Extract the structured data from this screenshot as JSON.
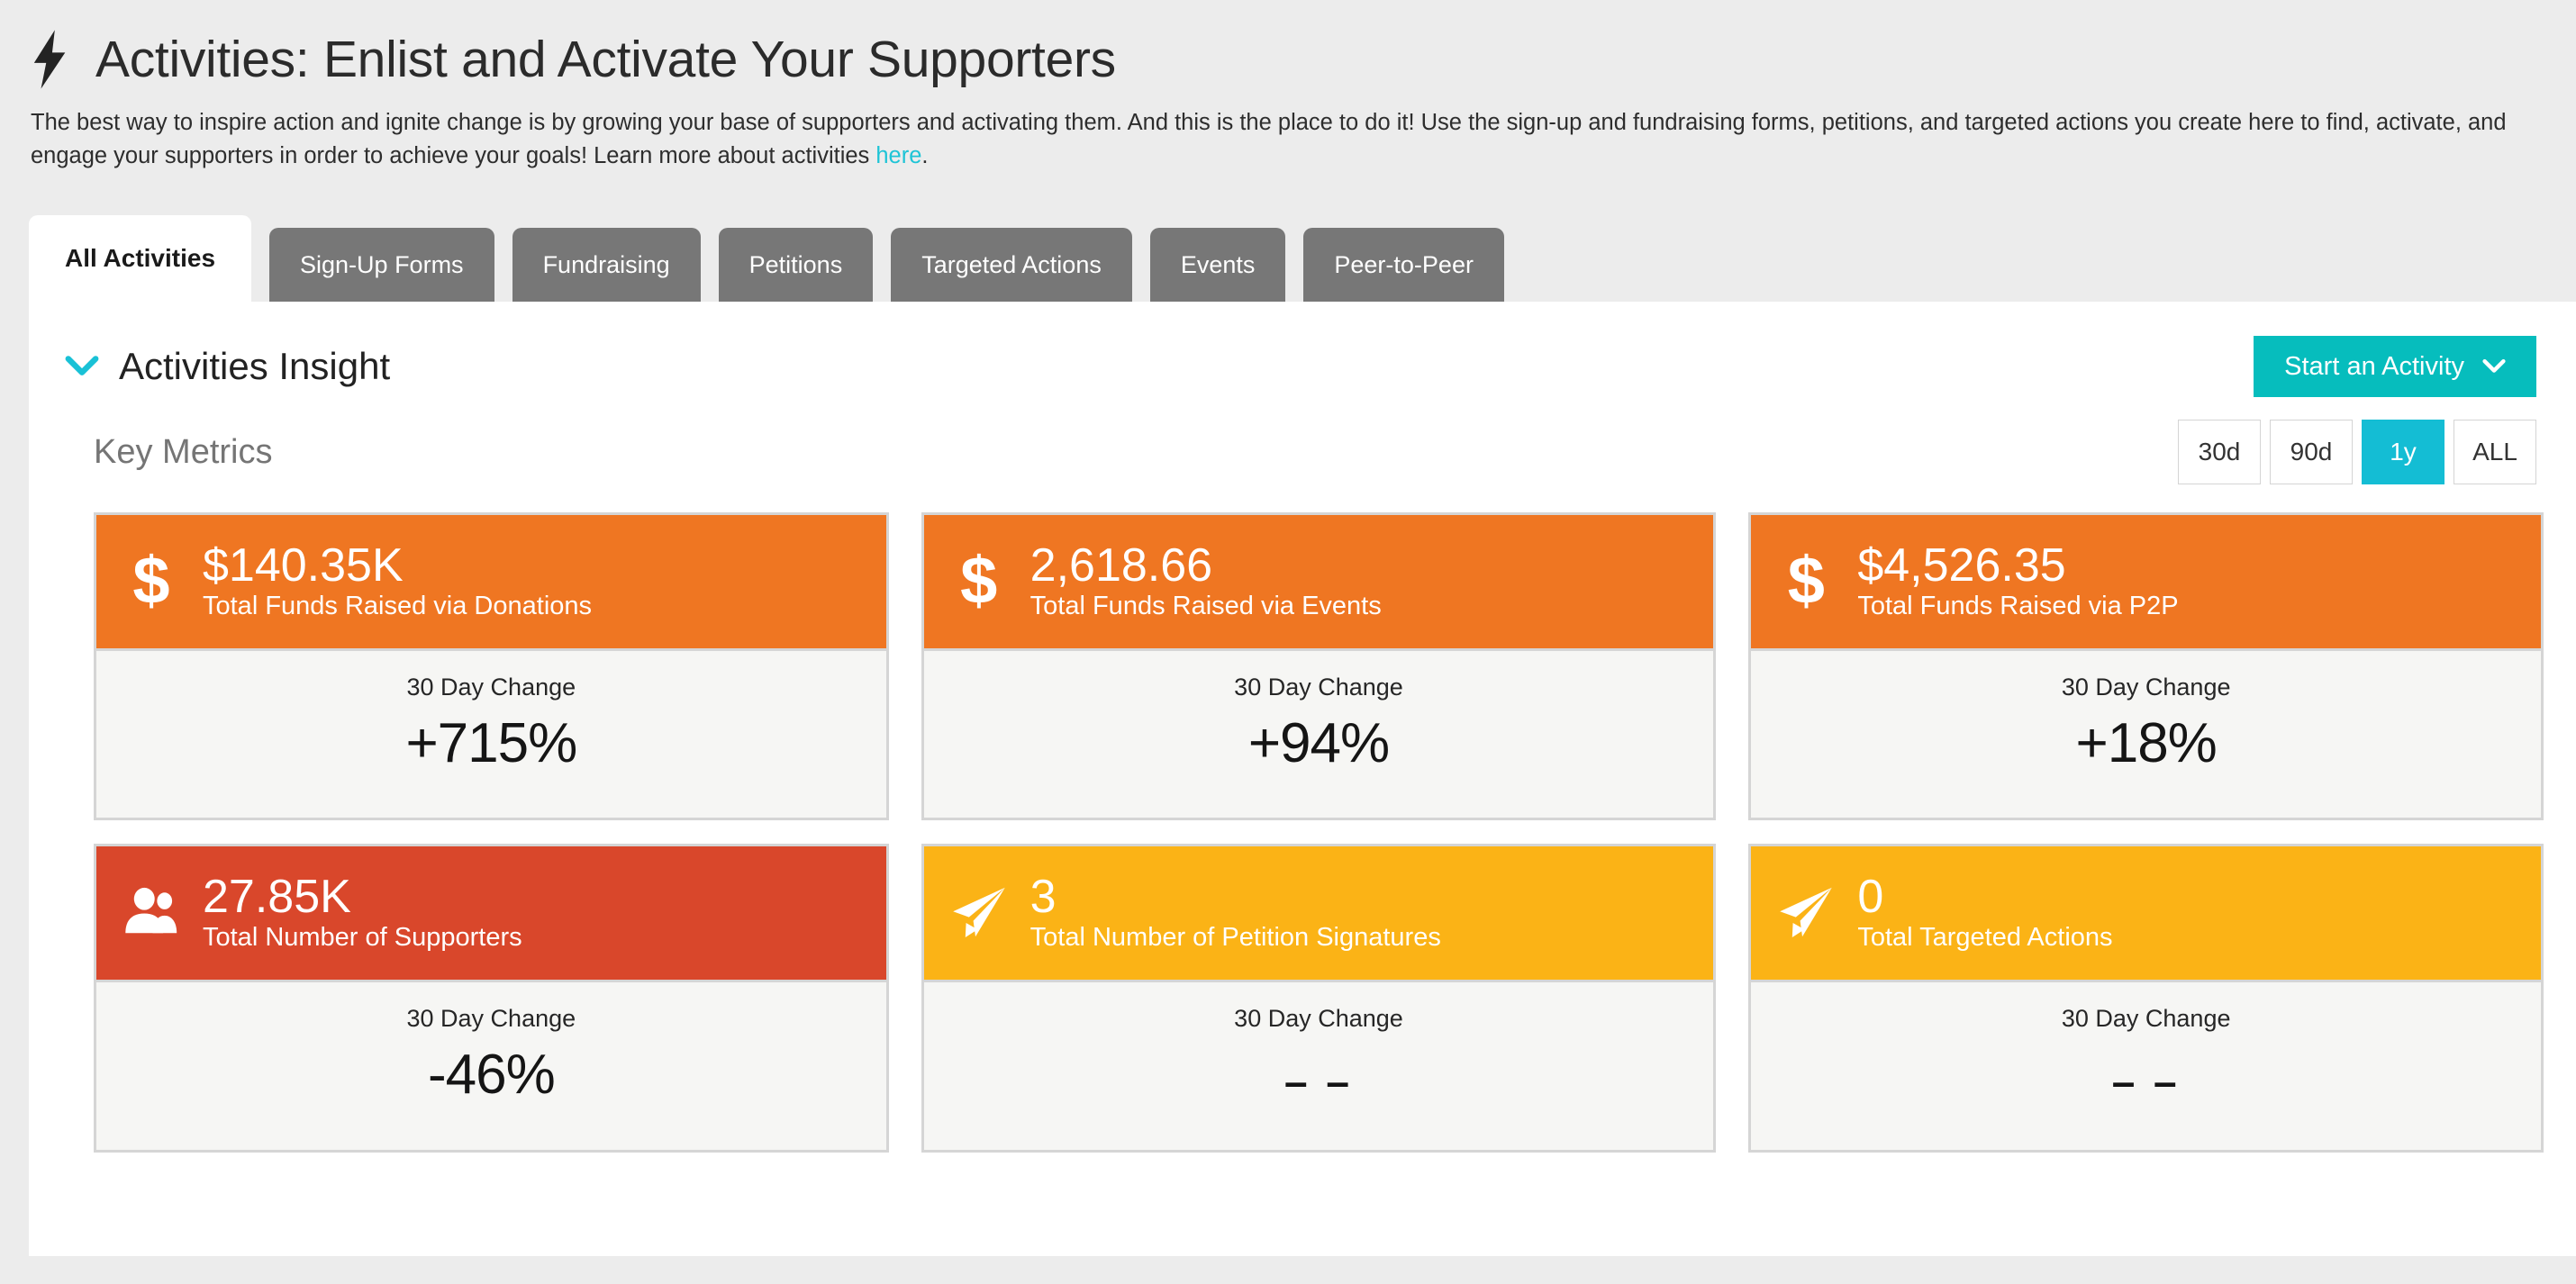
{
  "header": {
    "icon": "bolt-icon",
    "title": "Activities: Enlist and Activate Your Supporters"
  },
  "intro": {
    "text_before_link": "The best way to inspire action and ignite change is by growing your base of supporters and activating them. And this is the place to do it! Use the sign-up and fundraising forms, petitions, and targeted actions you create here to find, activate, and engage your supporters in order to achieve your goals! Learn more about activities ",
    "link_label": "here",
    "text_after_link": ".",
    "link_color": "#1ec4d6"
  },
  "tabs": [
    {
      "label": "All Activities",
      "active": true
    },
    {
      "label": "Sign-Up Forms",
      "active": false
    },
    {
      "label": "Fundraising",
      "active": false
    },
    {
      "label": "Petitions",
      "active": false
    },
    {
      "label": "Targeted Actions",
      "active": false
    },
    {
      "label": "Events",
      "active": false
    },
    {
      "label": "Peer-to-Peer",
      "active": false
    }
  ],
  "insight": {
    "title": "Activities Insight",
    "collapse_icon": "chevron-down-icon",
    "start_button": {
      "label": "Start an Activity",
      "icon": "chevron-down-icon",
      "color": "#06bdbd"
    }
  },
  "key_metrics": {
    "label": "Key Metrics",
    "ranges": [
      {
        "label": "30d",
        "active": false
      },
      {
        "label": "90d",
        "active": false
      },
      {
        "label": "1y",
        "active": true
      },
      {
        "label": "ALL",
        "active": false
      }
    ],
    "active_range_color": "#14bdd4"
  },
  "cards": [
    {
      "icon": "dollar-icon",
      "value": "$140.35K",
      "label": "Total Funds Raised via Donations",
      "header_color": "#ef7622",
      "change_label": "30 Day Change",
      "change_value": "+715%"
    },
    {
      "icon": "dollar-icon",
      "value": "2,618.66",
      "label": "Total Funds Raised via Events",
      "header_color": "#ef7622",
      "change_label": "30 Day Change",
      "change_value": "+94%"
    },
    {
      "icon": "dollar-icon",
      "value": "$4,526.35",
      "label": "Total Funds Raised via P2P",
      "header_color": "#ef7622",
      "change_label": "30 Day Change",
      "change_value": "+18%"
    },
    {
      "icon": "users-icon",
      "value": "27.85K",
      "label": "Total Number of Supporters",
      "header_color": "#d9472b",
      "change_label": "30 Day Change",
      "change_value": "-46%"
    },
    {
      "icon": "paper-plane-icon",
      "value": "3",
      "label": "Total Number of Petition Signatures",
      "header_color": "#fbb316",
      "change_label": "30 Day Change",
      "change_value": "– –"
    },
    {
      "icon": "paper-plane-icon",
      "value": "0",
      "label": "Total Targeted Actions",
      "header_color": "#fbb316",
      "change_label": "30 Day Change",
      "change_value": "– –"
    }
  ]
}
